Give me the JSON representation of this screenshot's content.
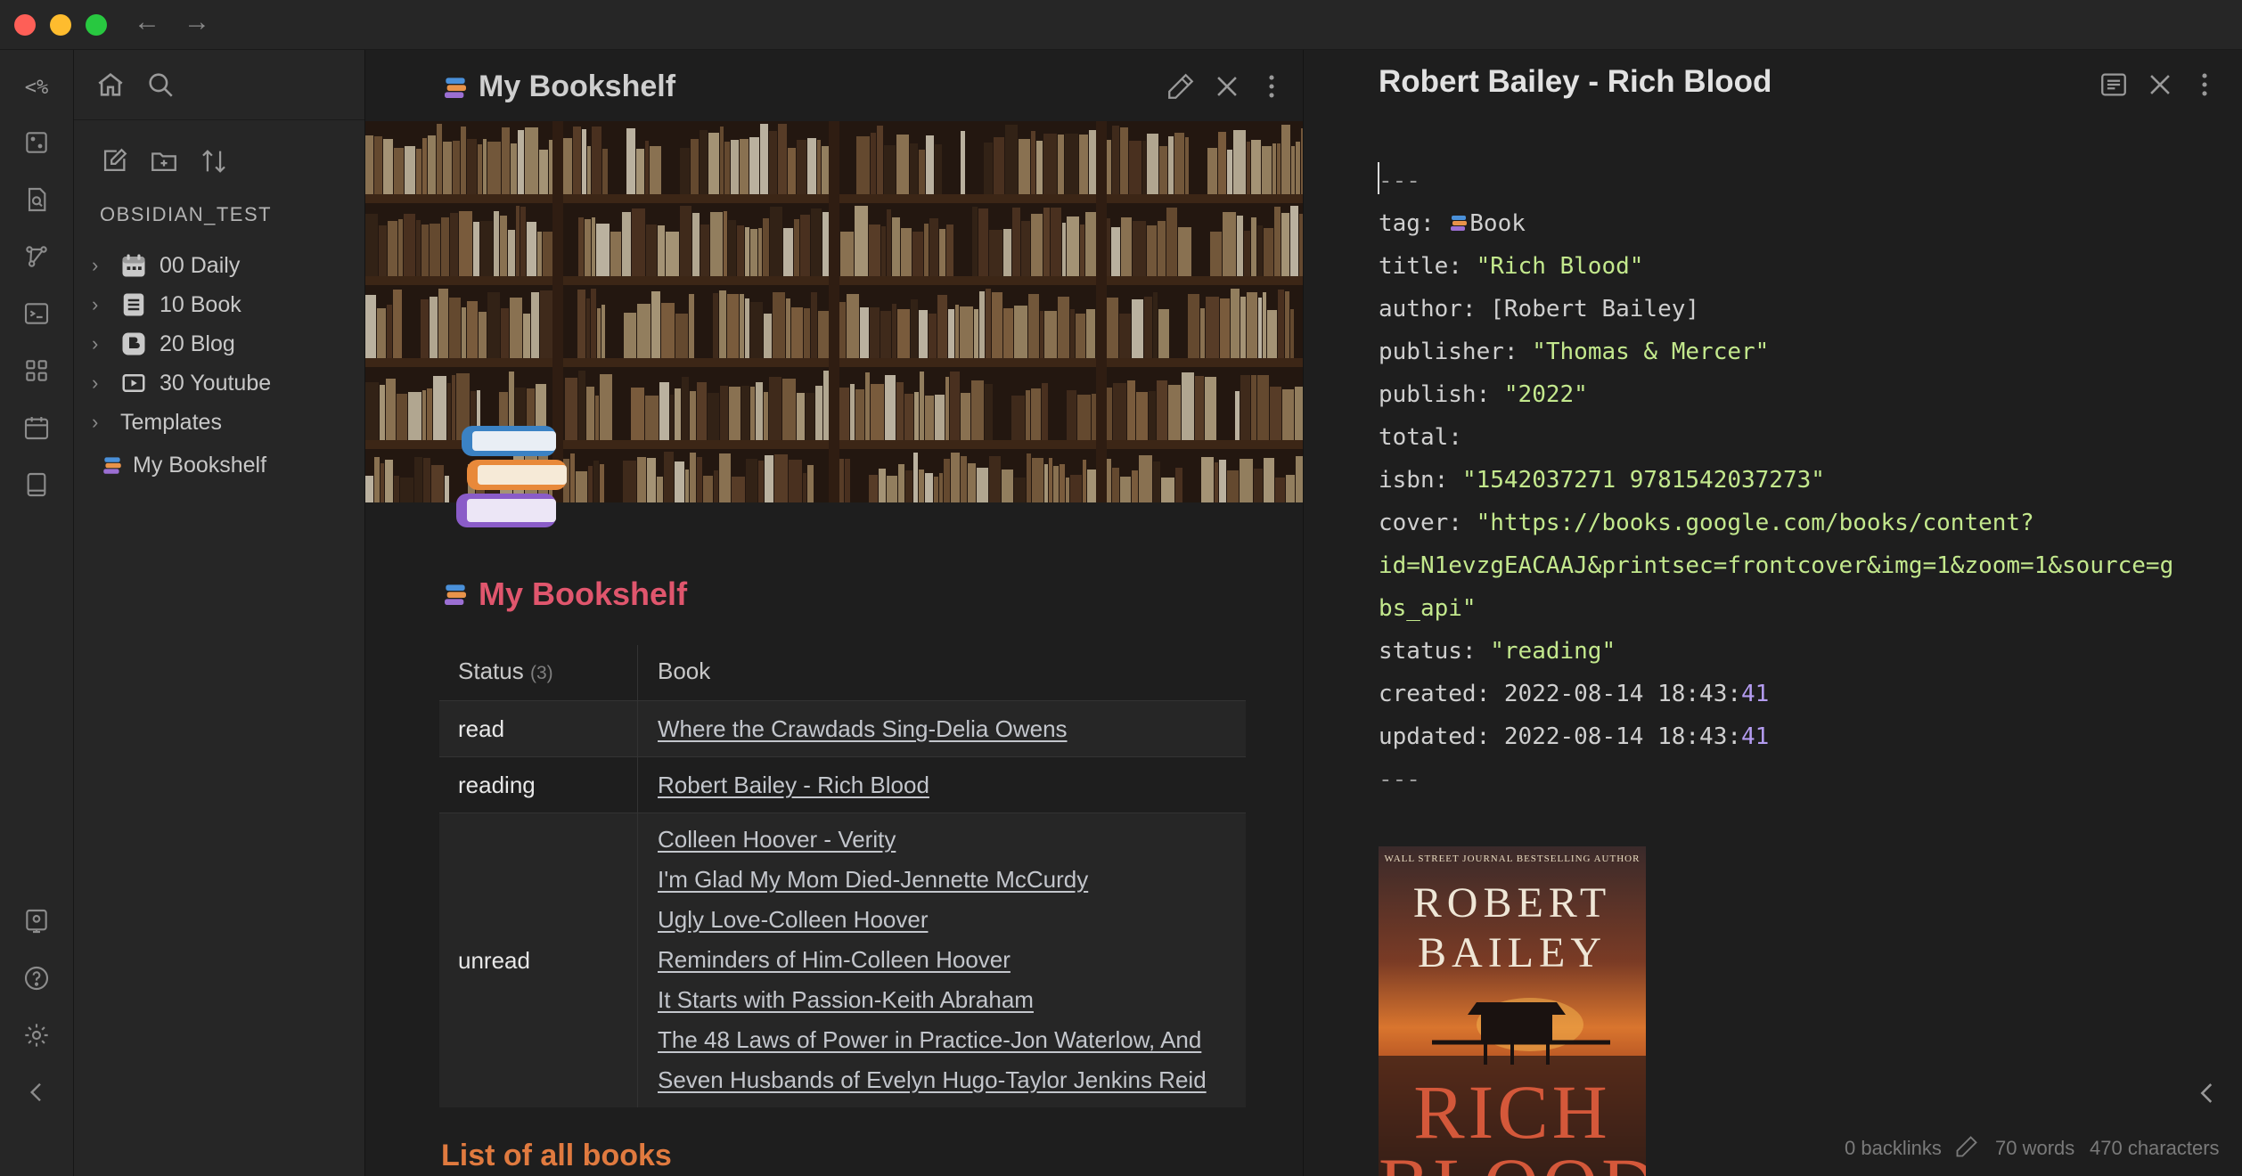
{
  "ribbon": {
    "templater_label": "<%"
  },
  "sidebar": {
    "vault_name": "OBSIDIAN_TEST",
    "items": [
      {
        "label": "00 Daily",
        "icon": "calendar-icon",
        "type": "folder"
      },
      {
        "label": "10 Book",
        "icon": "book-icon",
        "type": "folder"
      },
      {
        "label": "20 Blog",
        "icon": "blogger-icon",
        "type": "folder"
      },
      {
        "label": "30 Youtube",
        "icon": "youtube-icon",
        "type": "folder"
      },
      {
        "label": "Templates",
        "icon": "",
        "type": "folder"
      },
      {
        "label": "My Bookshelf",
        "icon": "books-emoji-icon",
        "type": "file"
      }
    ]
  },
  "middle_pane": {
    "title": "My Bookshelf",
    "heading": "My Bookshelf",
    "table": {
      "headers": {
        "status": "Status",
        "status_count": "(3)",
        "book": "Book"
      },
      "rows": [
        {
          "status": "read",
          "books": [
            "Where the Crawdads Sing-Delia Owens"
          ]
        },
        {
          "status": "reading",
          "books": [
            "Robert Bailey - Rich Blood"
          ]
        },
        {
          "status": "unread",
          "books": [
            "Colleen Hoover - Verity",
            "I'm Glad My Mom Died-Jennette McCurdy",
            "Ugly Love-Colleen Hoover",
            "Reminders of Him-Colleen Hoover",
            "It Starts with Passion-Keith Abraham",
            "The 48 Laws of Power in Practice-Jon Waterlow, And",
            "Seven Husbands of Evelyn Hugo-Taylor Jenkins Reid"
          ]
        }
      ]
    },
    "next_heading": "List of all books"
  },
  "right_pane": {
    "title": "Robert Bailey - Rich Blood",
    "frontmatter": {
      "delimiter": "---",
      "tag_key": "tag:",
      "tag_value": "Book",
      "title_key": "title:",
      "title_value": "\"Rich Blood\"",
      "author_key": "author:",
      "author_value": "[Robert Bailey]",
      "publisher_key": "publisher:",
      "publisher_value": "\"Thomas & Mercer\"",
      "publish_key": "publish:",
      "publish_value": "\"2022\"",
      "total_key": "total:",
      "isbn_key": "isbn:",
      "isbn_value": "\"1542037271 9781542037273\"",
      "cover_key": "cover:",
      "cover_line1": "\"https://books.google.com/books/content?",
      "cover_line2": "id=N1evzgEACAAJ&printsec=frontcover&img=1&zoom=1&source=g",
      "cover_line3": "bs_api\"",
      "status_key": "status:",
      "status_value": "\"reading\"",
      "created_key": "created:",
      "created_value": "2022-08-14 18:43:",
      "created_seconds": "41",
      "updated_key": "updated:",
      "updated_value": "2022-08-14 18:43:",
      "updated_seconds": "41"
    },
    "cover": {
      "tagline": "WALL STREET JOURNAL BESTSELLING AUTHOR",
      "author_line1": "ROBERT",
      "author_line2": "BAILEY",
      "title_line1": "RICH",
      "title_line2": "BLOOD"
    },
    "status_bar": {
      "backlinks": "0 backlinks",
      "words": "70 words",
      "characters": "470 characters"
    }
  },
  "colors": {
    "heading_pink": "#e0566d",
    "heading_orange": "#e07a3f",
    "yaml_string": "#c3e88d",
    "yaml_number": "#b49cf0"
  }
}
